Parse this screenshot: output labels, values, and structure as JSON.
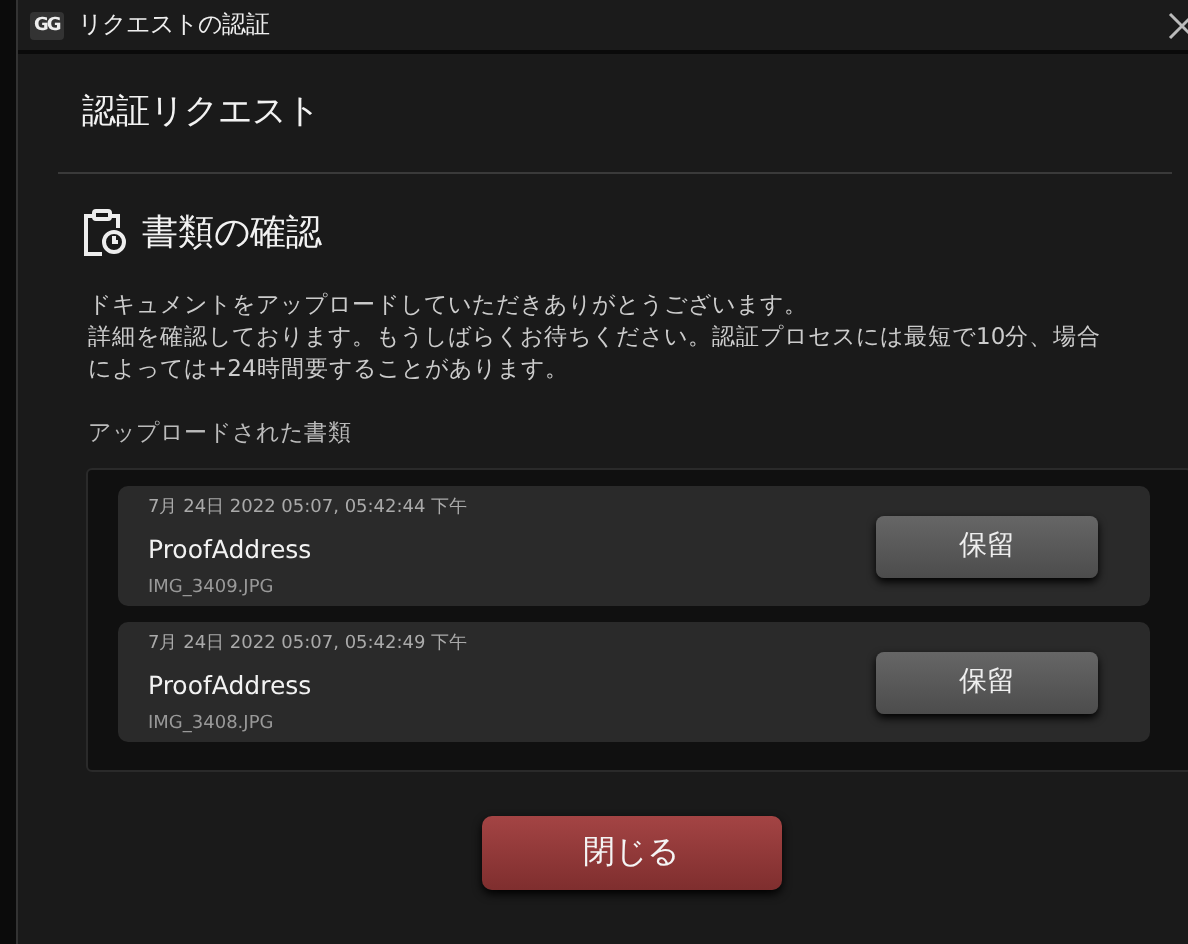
{
  "window": {
    "logo": "GG",
    "title": "リクエストの認証"
  },
  "heading": "認証リクエスト",
  "section": {
    "title": "書類の確認",
    "message_lines": [
      "ドキュメントをアップロードしていただきありがとうございます。",
      "詳細を確認しております。もうしばらくお待ちください。認証プロセスには最短で10分、場合によっては+24時間要することがあります。"
    ]
  },
  "uploads_label": "アップロードされた書類",
  "documents": [
    {
      "timestamp": "7月 24日 2022 05:07, 05:42:44 下午",
      "type": "ProofAddress",
      "file": "IMG_3409.JPG",
      "status": "保留"
    },
    {
      "timestamp": "7月 24日 2022 05:07, 05:42:49 下午",
      "type": "ProofAddress",
      "file": "IMG_3408.JPG",
      "status": "保留"
    }
  ],
  "close_button": "閉じる"
}
